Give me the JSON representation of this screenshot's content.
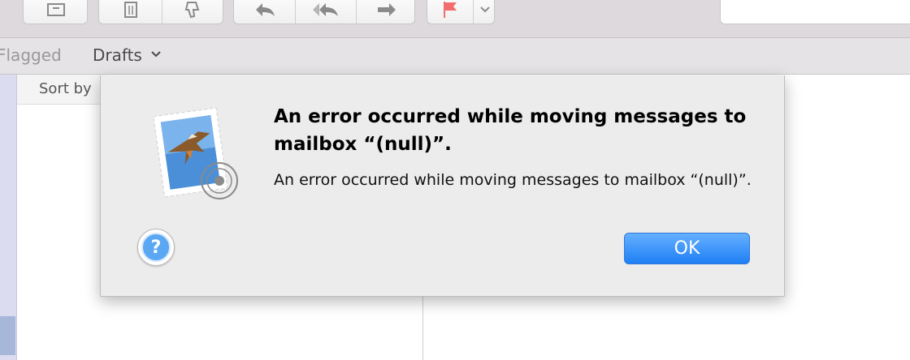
{
  "favorites": {
    "flagged": "Flagged",
    "drafts": "Drafts",
    "drafts_chevron": "⌄"
  },
  "message_list": {
    "sort_label": "Sort by"
  },
  "dialog": {
    "title": "An error occurred while moving messages to mailbox “(null)”.",
    "message": "An error occurred while moving messages to mailbox “(null)”.",
    "help_label": "?",
    "ok_label": "OK",
    "icon": "mail-stamp-icon"
  },
  "toolbar": {
    "icons": [
      "archive-icon",
      "trash-icon",
      "junk-icon",
      "reply-icon",
      "reply-all-icon",
      "forward-icon",
      "flag-icon",
      "chevron-down-icon"
    ],
    "flag_color": "#f26d6d"
  },
  "colors": {
    "accent": "#1e7ff5",
    "sidebar_selection": "#a6b7da"
  }
}
